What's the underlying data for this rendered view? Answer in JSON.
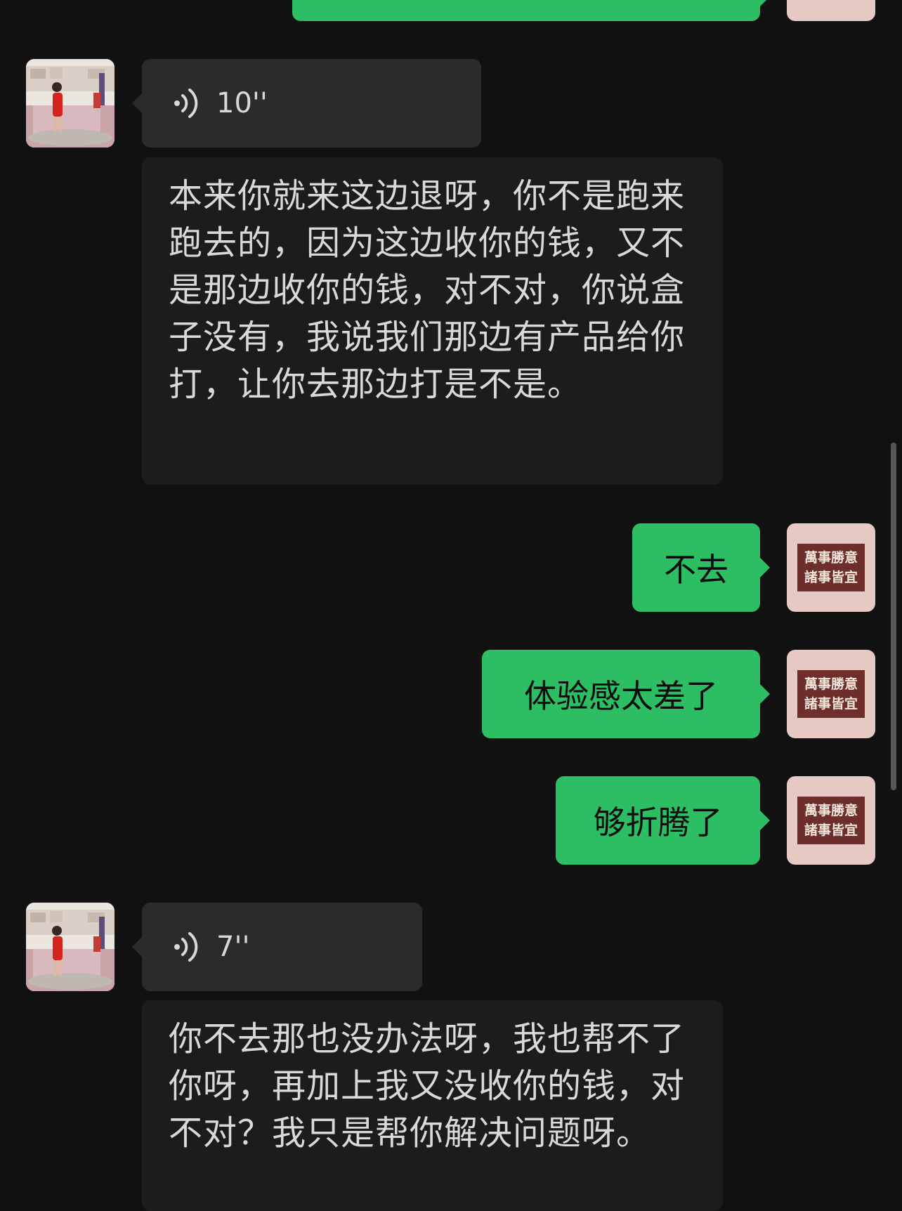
{
  "messages": {
    "voice1": {
      "duration": "10''"
    },
    "transcript1": "本来你就来这边退呀，你不是跑来跑去的，因为这边收你的钱，又不是那边收你的钱，对不对，你说盒子没有，我说我们那边有产品给你打，让你去那边打是不是。",
    "sent1": "不去",
    "sent2": "体验感太差了",
    "sent3": "够折腾了",
    "voice2": {
      "duration": "7''"
    },
    "transcript2": "你不去那也没办法呀，我也帮不了你呀，再加上我又没收你的钱，对不对？我只是帮你解决问题呀。"
  },
  "my_avatar": {
    "line1": "萬事勝意",
    "line2": "諸事皆宜"
  },
  "colors": {
    "background": "#111111",
    "sent_bubble": "#2dbd62",
    "received_bubble": "#2b2b2b",
    "transcript_bg": "#1c1c1c"
  },
  "icons": [
    "voice-wave-icon"
  ]
}
